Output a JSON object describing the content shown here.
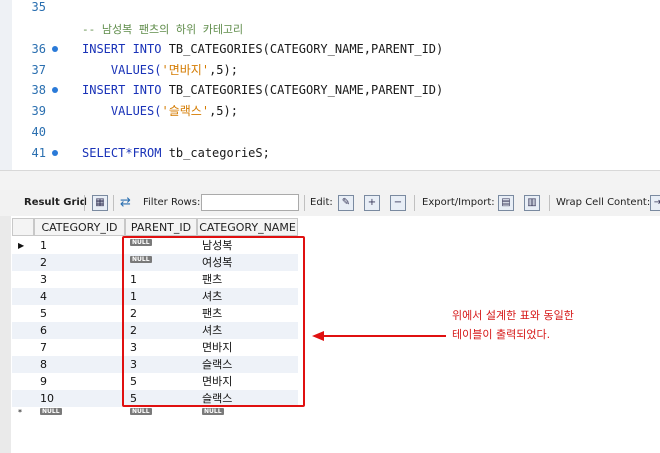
{
  "editor": {
    "lines": [
      {
        "num": "35",
        "dot": false,
        "comment": "",
        "parts": []
      },
      {
        "num": "",
        "dot": false,
        "comment": "-- 남성복 팬츠의 하위 카테고리",
        "parts": []
      },
      {
        "num": "36",
        "dot": true,
        "parts": [
          {
            "t": "INSERT INTO",
            "k": "kw"
          },
          {
            "t": " TB_CATEGORIES(CATEGORY_NAME,PARENT_ID)",
            "k": ""
          }
        ]
      },
      {
        "num": "37",
        "dot": false,
        "parts": [
          {
            "t": "    VALUES(",
            "k": "kw"
          },
          {
            "t": "'면바지'",
            "k": "str"
          },
          {
            "t": ",5);",
            "k": ""
          }
        ]
      },
      {
        "num": "38",
        "dot": true,
        "parts": [
          {
            "t": "INSERT INTO",
            "k": "kw"
          },
          {
            "t": " TB_CATEGORIES(CATEGORY_NAME,PARENT_ID)",
            "k": ""
          }
        ]
      },
      {
        "num": "39",
        "dot": false,
        "parts": [
          {
            "t": "    VALUES(",
            "k": "kw"
          },
          {
            "t": "'슬랙스'",
            "k": "str"
          },
          {
            "t": ",5);",
            "k": ""
          }
        ]
      },
      {
        "num": "40",
        "dot": false,
        "parts": []
      },
      {
        "num": "41",
        "dot": true,
        "parts": [
          {
            "t": "SELECT*FROM",
            "k": "kw"
          },
          {
            "t": " tb_categorieS;",
            "k": ""
          }
        ]
      }
    ]
  },
  "toolbar": {
    "result_grid": "Result Grid",
    "filter_rows": "Filter Rows:",
    "edit": "Edit:",
    "export_import": "Export/Import:",
    "wrap_cell": "Wrap Cell Content:"
  },
  "grid": {
    "columns": [
      "CATEGORY_ID",
      "PARENT_ID",
      "CATEGORY_NAME"
    ],
    "null_label": "NULL",
    "rows": [
      {
        "id": "1",
        "parent": null,
        "name": "남성복"
      },
      {
        "id": "2",
        "parent": null,
        "name": "여성복"
      },
      {
        "id": "3",
        "parent": "1",
        "name": "팬츠"
      },
      {
        "id": "4",
        "parent": "1",
        "name": "셔츠"
      },
      {
        "id": "5",
        "parent": "2",
        "name": "팬츠"
      },
      {
        "id": "6",
        "parent": "2",
        "name": "셔츠"
      },
      {
        "id": "7",
        "parent": "3",
        "name": "면바지"
      },
      {
        "id": "8",
        "parent": "3",
        "name": "슬랙스"
      },
      {
        "id": "9",
        "parent": "5",
        "name": "면바지"
      },
      {
        "id": "10",
        "parent": "5",
        "name": "슬랙스"
      }
    ]
  },
  "annotation": {
    "line1": "위에서 설계한 표와 동일한",
    "line2": "테이블이 출력되었다."
  }
}
